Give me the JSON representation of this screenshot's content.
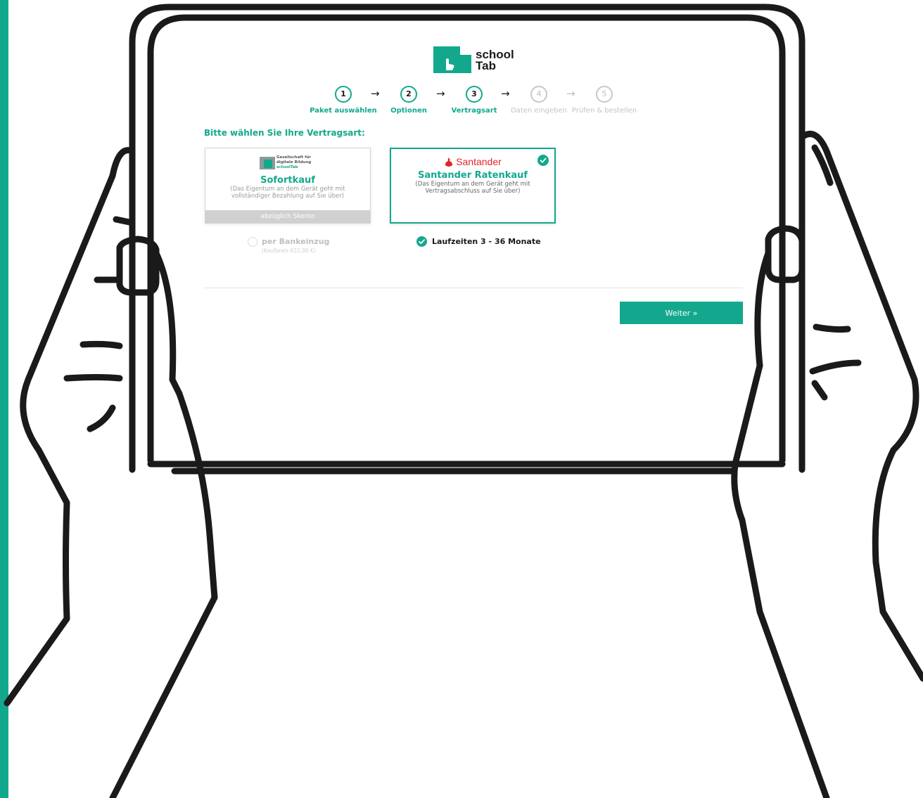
{
  "brand": {
    "logo_line1": "school",
    "logo_line2": "Tab",
    "accent": "#13a88d"
  },
  "stepper": [
    {
      "num": "1",
      "label": "Paket auswählen",
      "active": true
    },
    {
      "num": "2",
      "label": "Optionen",
      "active": true
    },
    {
      "num": "3",
      "label": "Vertragsart",
      "active": true
    },
    {
      "num": "4",
      "label": "Daten eingeben",
      "active": false
    },
    {
      "num": "5",
      "label": "Prüfen & bestellen",
      "active": false
    }
  ],
  "arrow": "→",
  "heading": "Bitte wählen Sie Ihre Vertragsart:",
  "cards": {
    "sofortkauf": {
      "logo_line1": "Gesellschaft für",
      "logo_line2": "digitale Bildung",
      "logo_line3": "schoolTab",
      "title": "Sofortkauf",
      "desc": "(Das Eigentum an dem Gerät geht mit vollständiger Bezahlung auf Sie über)",
      "footer": "abzüglich Skonto"
    },
    "ratenkauf": {
      "brand": "Santander",
      "title": "Santander Ratenkauf",
      "desc": "(Das Eigentum an dem Gerät geht mit Vertragsabschluss auf Sie über)",
      "brand_color": "#e0262b"
    }
  },
  "options": {
    "bankeinzug_label": "per Bankeinzug",
    "bankeinzug_price": "(Kaufpreis 622,00 €)",
    "laufzeiten_label": "Laufzeiten 3 - 36 Monate"
  },
  "weiter_label": "Weiter »"
}
